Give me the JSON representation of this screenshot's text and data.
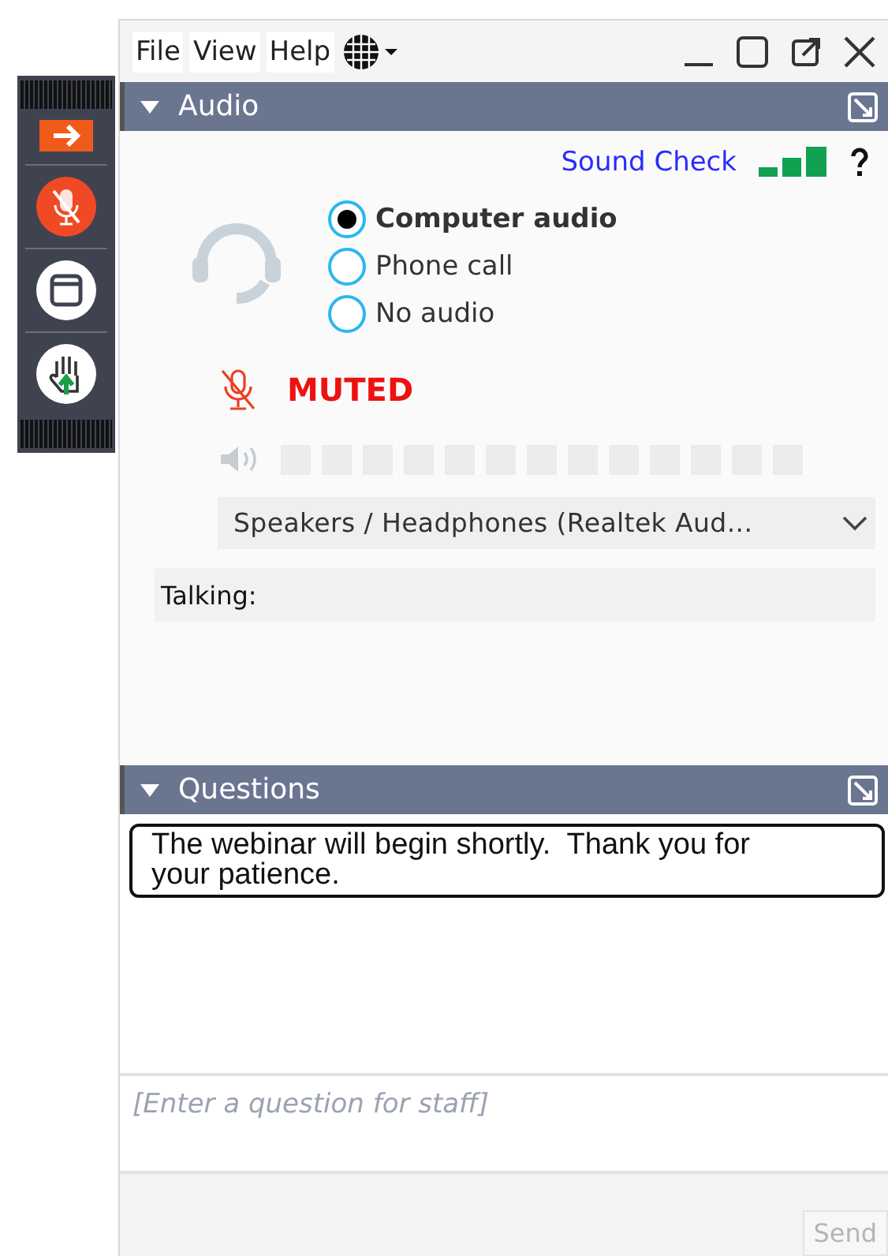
{
  "menu": [
    "File",
    "View",
    "Help"
  ],
  "audio": {
    "title": "Audio",
    "expanded": true,
    "sound_check": "Sound Check",
    "options": [
      {
        "label": "Computer audio",
        "selected": true
      },
      {
        "label": "Phone call",
        "selected": false
      },
      {
        "label": "No audio",
        "selected": false
      }
    ],
    "muted": true,
    "muted_label": "MUTED",
    "level": 0,
    "device": "Speakers / Headphones (Realtek Aud...",
    "talking_label": "Talking:"
  },
  "questions": {
    "title": "Questions",
    "expanded": true,
    "messages": [
      "The webinar will begin shortly.  Thank you for your patience."
    ],
    "placeholder": "[Enter a question for staff]",
    "send": {
      "label": "Send",
      "disabled": true
    }
  }
}
